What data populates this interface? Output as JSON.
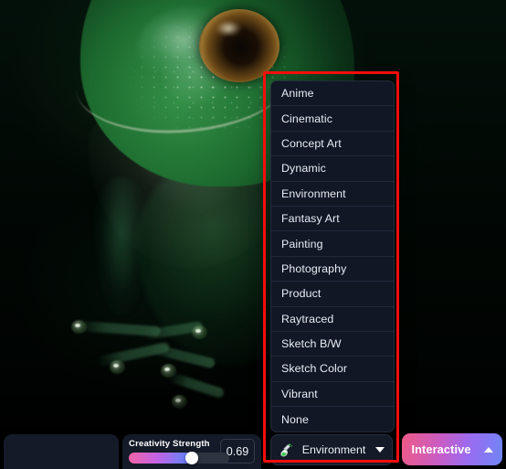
{
  "app": {
    "background_image": "frog-photo"
  },
  "style_dropdown": {
    "open": true,
    "selected": "Environment",
    "icon": "flask-icon",
    "caret": "chevron-down-icon",
    "options": [
      "Anime",
      "Cinematic",
      "Concept Art",
      "Dynamic",
      "Environment",
      "Fantasy Art",
      "Painting",
      "Photography",
      "Product",
      "Raytraced",
      "Sketch B/W",
      "Sketch Color",
      "Vibrant",
      "None"
    ]
  },
  "creativity": {
    "label": "Creativity Strength",
    "value": "0.69",
    "slider_percent": 63,
    "gradient": [
      "#f263a6",
      "#c263e6",
      "#7a7bf5",
      "#5f7ef8"
    ]
  },
  "interactive_button": {
    "label": "Interactive",
    "caret": "chevron-up-icon",
    "gradient": [
      "#ef5a86",
      "#c95cc4",
      "#9b6bf0",
      "#6e86f7"
    ]
  },
  "annotation": {
    "highlight_color": "#f60d0d"
  }
}
